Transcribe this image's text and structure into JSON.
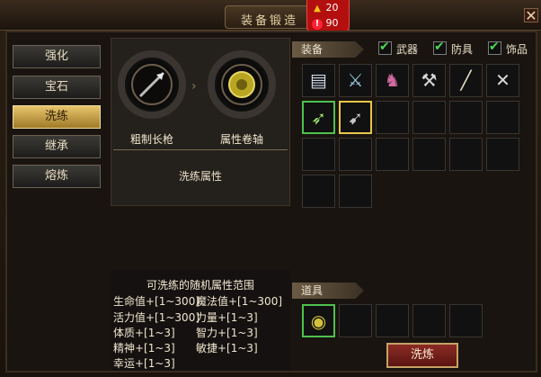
{
  "window": {
    "title": "装备锻造",
    "close_icon": "close-icon"
  },
  "alerts": {
    "warning_count": "20",
    "error_count": "90"
  },
  "menu": [
    {
      "label": "强化",
      "active": false
    },
    {
      "label": "宝石",
      "active": false
    },
    {
      "label": "洗练",
      "active": true
    },
    {
      "label": "继承",
      "active": false
    },
    {
      "label": "熔炼",
      "active": false
    }
  ],
  "forge": {
    "left_label": "粗制长枪",
    "right_label": "属性卷轴",
    "props_title": "洗练属性",
    "desc_title": "可洗练的随机属性范围",
    "props": [
      "生命值+[1~300]",
      "魔法值+[1~300]",
      "活力值+[1~300]",
      "力量+[1~3]",
      "体质+[1~3]",
      "智力+[1~3]",
      "精神+[1~3]",
      "敏捷+[1~3]",
      "幸运+[1~3]"
    ]
  },
  "equipment": {
    "section_label": "装备",
    "filters": [
      {
        "label": "武器",
        "checked": true
      },
      {
        "label": "防具",
        "checked": true
      },
      {
        "label": "饰品",
        "checked": true
      }
    ]
  },
  "items_section": {
    "label": "道具"
  },
  "refine_button": "洗炼"
}
